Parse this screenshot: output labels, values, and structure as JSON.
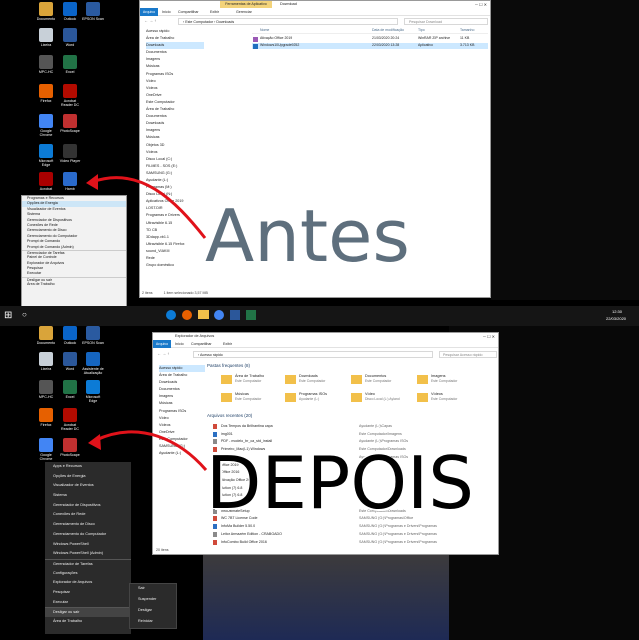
{
  "top_desktop": {
    "icons": [
      {
        "label": "Documento",
        "color": "#d9a43a"
      },
      {
        "label": "Outlook",
        "color": "#0a64c8"
      },
      {
        "label": "EPSON Scan",
        "color": "#2a5aa0"
      },
      {
        "label": "Lixeira",
        "color": "#c8d0d8"
      },
      {
        "label": "Word",
        "color": "#2b579a"
      },
      {
        "label": "MPC-HC",
        "color": "#555"
      },
      {
        "label": "Excel",
        "color": "#217346"
      },
      {
        "label": "Firefox",
        "color": "#e66000"
      },
      {
        "label": "Acrobat Reader DC",
        "color": "#b30b00"
      },
      {
        "label": "Google Chrome",
        "color": "#4285f4"
      },
      {
        "label": "PhotoScape",
        "color": "#c03030"
      },
      {
        "label": "Microsoft Edge",
        "color": "#0c7bd6"
      },
      {
        "label": "Vídeo Player",
        "color": "#333"
      },
      {
        "label": "Acrobat",
        "color": "#a00"
      },
      {
        "label": "Hamb",
        "color": "#2a6acb"
      }
    ],
    "menu": [
      "Programas e Recursos",
      "Opções de Energia",
      "Visualizador de Eventos",
      "Sistema",
      "Gerenciador de Dispositivos",
      "Conexões de Rede",
      "Gerenciamento de Disco",
      "Gerenciamento do Computador",
      "Prompt de Comando",
      "Prompt de Comando (Admin)",
      "Gerenciador de Tarefas",
      "Painel de Controle",
      "Explorador de Arquivos",
      "Pesquisar",
      "Executar",
      "Desligar ou sair",
      "Área de Trabalho"
    ]
  },
  "top_window": {
    "ribbon_tabs": [
      "Arquivo",
      "Início",
      "Compartilhar",
      "Exibir"
    ],
    "context_tab": "Ferramentas de Aplicativo",
    "context_sub": "Gerenciar",
    "title": "Download",
    "breadcrumb": "› Este Computador › Downloads",
    "search_placeholder": "Pesquisar Download",
    "columns": [
      "Nome",
      "Data de modificação",
      "Tipo",
      "Tamanho"
    ],
    "files": [
      {
        "name": "Ativação Office 2019",
        "date": "21/03/2020 20:24",
        "type": "WinRAR ZIP archive",
        "size": "11 KB"
      },
      {
        "name": "Windows10Upgrade9252",
        "date": "22/03/2020 13:28",
        "type": "Aplicativo",
        "size": "3.713 KB"
      }
    ],
    "nav": [
      "Acesso rápido",
      "Área de Trabalho",
      "Downloads",
      "Documentos",
      "Imagens",
      "Músicas",
      "Programas ISOs",
      "Vídeo",
      "Vídeos",
      "OneDrive",
      "Este Computador",
      "Área de Trabalho",
      "Documentos",
      "Downloads",
      "Imagens",
      "Músicas",
      "Objetos 3D",
      "Vídeos",
      "Disco Local (C:)",
      "FILMES - SOS (E:)",
      "SAMSUNG (G:)",
      "Ayudante (L:)",
      "Programas (M:)",
      "Disco Local (N:)"
    ],
    "extra_nav": [
      "Aplicativos Office 2019",
      "LOST.DIR",
      "Programas e Drivers",
      "Ultravisible 6.15",
      "TD CB",
      "3Ddapp.vb1.1",
      "Ultravisible 6.15 Firefox",
      "sound_VIAKIII",
      "Rede",
      "Grupo doméstico"
    ],
    "status_items": "2 itens",
    "status_selected": "1 item selecionado  3,57 MB"
  },
  "top_label": "Antes",
  "taskbar": {
    "time": "12:30",
    "date": "22/03/2020"
  },
  "bottom_desktop": {
    "icons": [
      {
        "label": "Documento",
        "color": "#d9a43a"
      },
      {
        "label": "Outlook",
        "color": "#0a64c8"
      },
      {
        "label": "EPSON Scan",
        "color": "#2a5aa0"
      },
      {
        "label": "Lixeira",
        "color": "#c8d0d8"
      },
      {
        "label": "Word",
        "color": "#2b579a"
      },
      {
        "label": "Assistente de Atualização",
        "color": "#1565c0"
      },
      {
        "label": "MPC-HC",
        "color": "#555"
      },
      {
        "label": "Excel",
        "color": "#217346"
      },
      {
        "label": "Microsoft Edge",
        "color": "#0c7bd6"
      },
      {
        "label": "Firefox",
        "color": "#e66000"
      },
      {
        "label": "Acrobat Reader DC",
        "color": "#b30b00"
      },
      {
        "label": "Google Chrome",
        "color": "#4285f4"
      },
      {
        "label": "PhotoScape",
        "color": "#c03030"
      }
    ],
    "menu": [
      "Apps e Recursos",
      "Opções de Energia",
      "Visualizador de Eventos",
      "Sistema",
      "Gerenciador de Dispositivos",
      "Conexões de Rede",
      "Gerenciamento de Disco",
      "Gerenciamento do Computador",
      "Windows PowerShell",
      "Windows PowerShell (Admin)",
      "Gerenciador de Tarefas",
      "Configurações",
      "Explorador de Arquivos",
      "Pesquisar",
      "Executar",
      "Desligar ou sair",
      "Área de Trabalho"
    ],
    "submenu": [
      "Sair",
      "Suspender",
      "Desligar",
      "Reiniciar"
    ]
  },
  "bottom_window": {
    "title": "Explorador de Arquivos",
    "ribbon_tabs": [
      "Arquivo",
      "Início",
      "Compartilhar",
      "Exibir"
    ],
    "breadcrumb": "› Acesso rápido",
    "search_placeholder": "Pesquisar Acesso rápido",
    "frequent_header": "Pastas frequentes (8)",
    "frequent": [
      {
        "name": "Área de Trabalho",
        "sub": "Este Computador"
      },
      {
        "name": "Downloads",
        "sub": "Este Computador"
      },
      {
        "name": "Documentos",
        "sub": "Este Computador"
      },
      {
        "name": "Imagens",
        "sub": "Este Computador"
      },
      {
        "name": "Músicas",
        "sub": "Este Computador"
      },
      {
        "name": "Programas ISOs",
        "sub": "Ayudante (L:)"
      },
      {
        "name": "Vídeo",
        "sub": "Disco Local (L:) Ayland"
      },
      {
        "name": "Vídeos",
        "sub": "Este Computador"
      }
    ],
    "recent_header": "Arquivos recentes (20)",
    "recent": [
      {
        "name": "Dos Tempos da Brilhantina capa",
        "loc": "Ayudante (L:)\\Capas"
      },
      {
        "name": "img001",
        "loc": "Este Computador\\Imagens"
      },
      {
        "name": "PDF - modelo_br_ca_std_install",
        "loc": "Ayudante (L:)\\Programas ISOs"
      },
      {
        "name": "Primeiro_Mac(L1) Windows",
        "loc": "Este Computador\\Downloads"
      },
      {
        "name": "office 2016",
        "loc": "Ayudante (L:)\\Programas ISOs"
      },
      {
        "name": "office 2019",
        "loc": ""
      },
      {
        "name": "Office 2016",
        "loc": ""
      },
      {
        "name": "Ativação Office 2019",
        "loc": ""
      },
      {
        "name": "Action (7) 6.8",
        "loc": ""
      },
      {
        "name": "Action (7) 6.8",
        "loc": ""
      },
      {
        "name": "Action (7) 6.8",
        "loc": ""
      },
      {
        "name": "InfoUltimateSetup",
        "loc": "Este Computador\\Downloads"
      },
      {
        "name": "WC 7BT License Code",
        "loc": "SAMSUNG (G:)\\Programas\\Office"
      },
      {
        "name": "InfoMa Builder 5.50.0",
        "loc": "SAMSUNG (G:)\\Programas e Drivers\\Programas"
      },
      {
        "name": "Leitor Armazém Edition - CRABGADO",
        "loc": "SAMSUNG (G:)\\Programas e Drivers\\Programas"
      },
      {
        "name": "InfoCombo Build Office 2016",
        "loc": "SAMSUNG (G:)\\Programas e Drivers\\Programas"
      }
    ],
    "nav": [
      "Acesso rápido",
      "Área de Trabalho",
      "Downloads",
      "Documentos",
      "Imagens",
      "Músicas",
      "Programas ISOs",
      "Vídeo",
      "Vídeos",
      "OneDrive",
      "Este Computador",
      "SAMSUNG (G:)",
      "Ayudante (L:)"
    ],
    "status_items": "20 itens"
  },
  "bottom_label": "DEPOIS",
  "colors": {
    "arrow": "#e0121a",
    "explorer_accent": "#0078d7",
    "ribbon_context": "#f3d37a"
  }
}
